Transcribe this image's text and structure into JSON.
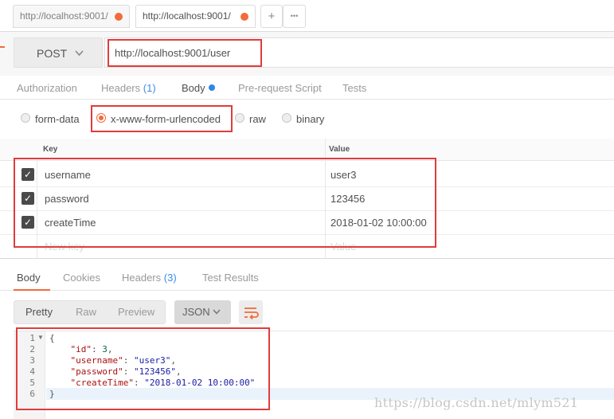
{
  "tabs": [
    {
      "label": "http://localhost:9001/",
      "active": false
    },
    {
      "label": "http://localhost:9001/",
      "active": true
    }
  ],
  "tab_actions": {
    "add": "+",
    "more": "•••"
  },
  "request": {
    "method": "POST",
    "url": "http://localhost:9001/user"
  },
  "request_tabs": {
    "authorization": "Authorization",
    "headers": "Headers",
    "headers_count": "(1)",
    "body": "Body",
    "prerequest": "Pre-request Script",
    "tests": "Tests"
  },
  "body_types": {
    "form_data": "form-data",
    "urlencoded": "x-www-form-urlencoded",
    "raw": "raw",
    "binary": "binary",
    "selected": "x-www-form-urlencoded"
  },
  "params": {
    "key_header": "Key",
    "value_header": "Value",
    "rows": [
      {
        "key": "username",
        "value": "user3",
        "checked": true
      },
      {
        "key": "password",
        "value": "123456",
        "checked": true
      },
      {
        "key": "createTime",
        "value": "2018-01-02 10:00:00",
        "checked": true
      }
    ],
    "new_key_placeholder": "New key",
    "value_placeholder": "Value"
  },
  "response_tabs": {
    "body": "Body",
    "cookies": "Cookies",
    "headers": "Headers",
    "headers_count": "(3)",
    "test_results": "Test Results"
  },
  "view_modes": {
    "pretty": "Pretty",
    "raw": "Raw",
    "preview": "Preview"
  },
  "format": "JSON",
  "code": {
    "line_numbers": [
      "1",
      "2",
      "3",
      "4",
      "5",
      "6"
    ],
    "open_brace": "{",
    "close_brace": "}",
    "id_key": "\"id\"",
    "id_value": "3",
    "username_key": "\"username\"",
    "username_value": "\"user3\"",
    "password_key": "\"password\"",
    "password_value": "\"123456\"",
    "createtime_key": "\"createTime\"",
    "createtime_value": "\"2018-01-02 10:00:00\""
  },
  "watermark": "https://blog.csdn.net/mlym521",
  "colors": {
    "accent": "#f26b3a",
    "link": "#3c8ce7",
    "annotation": "#e03c3c"
  }
}
